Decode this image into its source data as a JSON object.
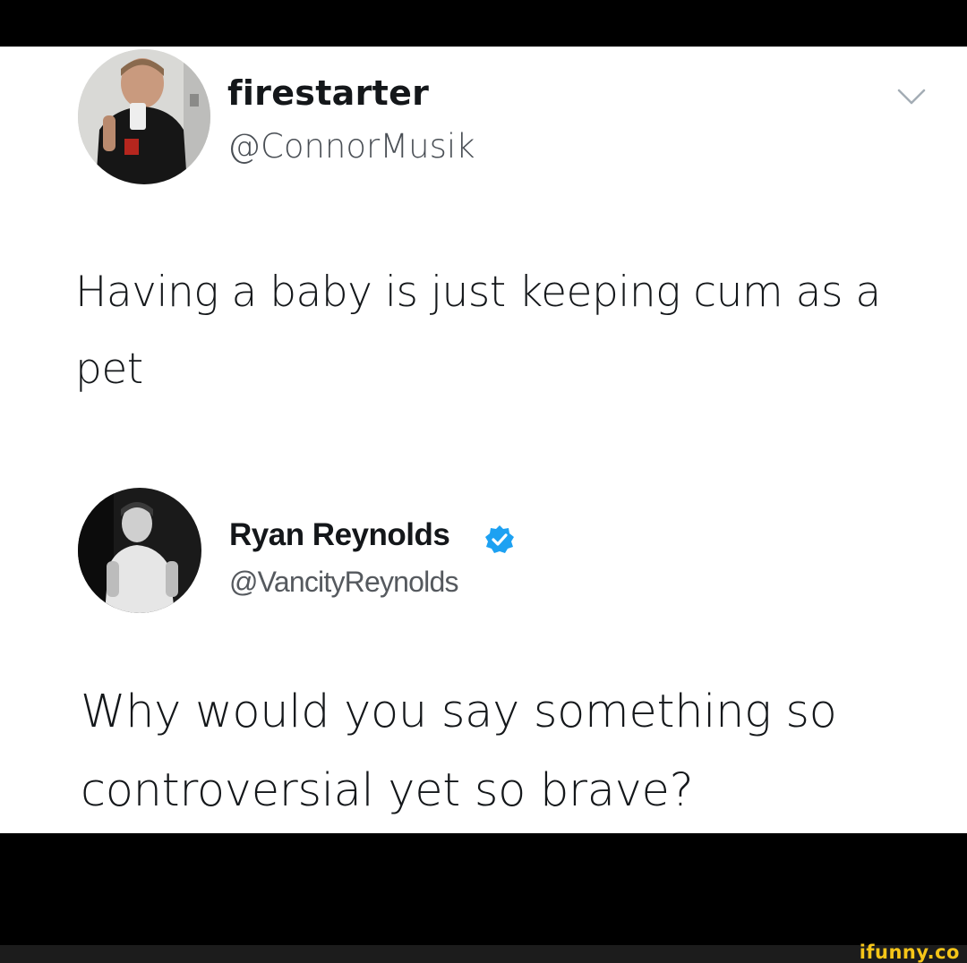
{
  "tweet1": {
    "display_name": "firestarter",
    "handle": "@ConnorMusik",
    "avatar_icon": "user-avatar-photo",
    "menu_icon": "chevron-down-icon",
    "text": "Having a baby is just keeping cum as a pet"
  },
  "tweet2": {
    "display_name": "Ryan Reynolds",
    "handle": "@VancityReynolds",
    "avatar_icon": "user-avatar-photo",
    "verified_icon": "verified-badge-icon",
    "verified_color": "#1da1f2",
    "text": "Why would you say something so controversial yet so brave?"
  },
  "watermark": "ifunny.co",
  "colors": {
    "background": "#ffffff",
    "text": "#14171a",
    "watermark": "#f5c518"
  }
}
